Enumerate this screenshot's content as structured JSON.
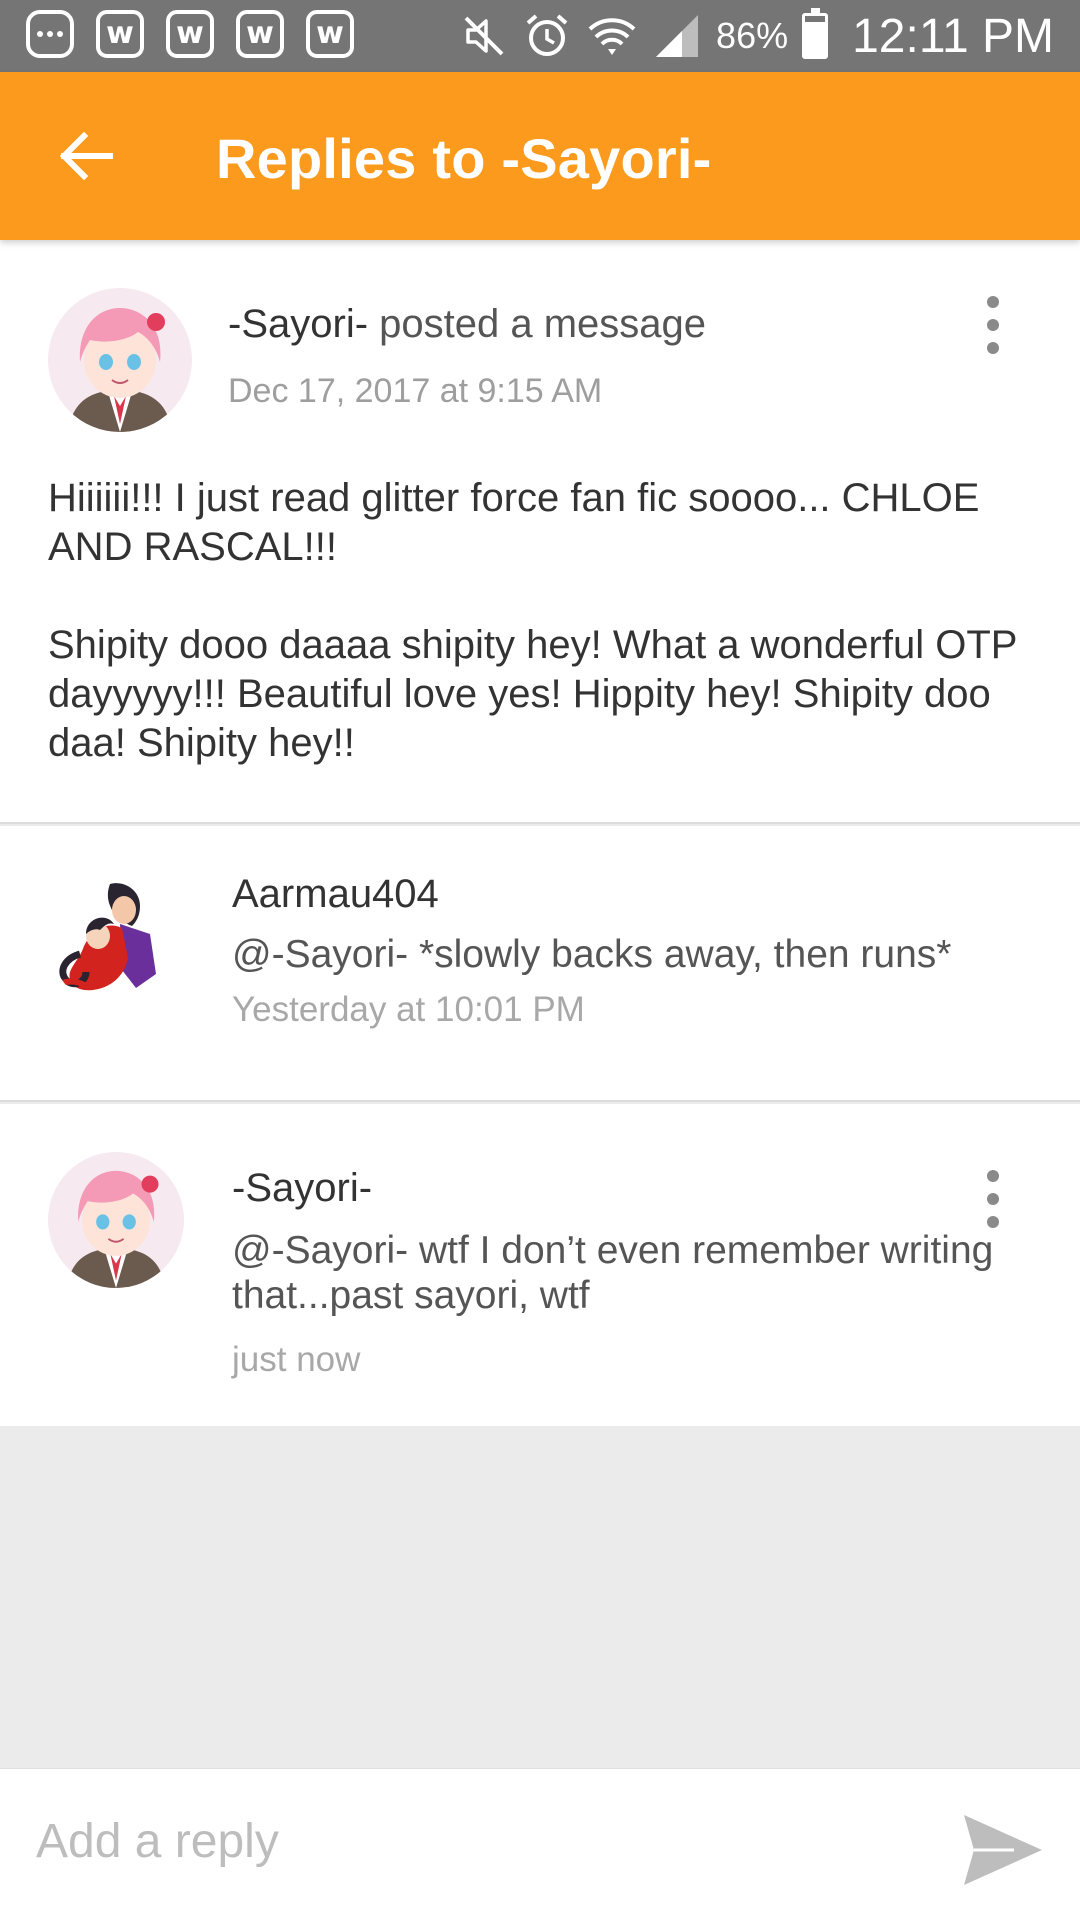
{
  "status_bar": {
    "notification_icons": [
      "more-icon",
      "webtoon-icon",
      "webtoon-icon",
      "webtoon-icon",
      "webtoon-icon"
    ],
    "right_icons": [
      "mute-icon",
      "alarm-icon",
      "wifi-icon",
      "signal-icon"
    ],
    "battery_percent": "86%",
    "battery_level": 0.86,
    "time": "12:11 PM"
  },
  "app_bar": {
    "title": "Replies to -Sayori-",
    "color": "#fb9a1c",
    "back_icon": "arrow-left-icon"
  },
  "post": {
    "username": "-Sayori-",
    "action": " posted a message",
    "timestamp": "Dec 17, 2017 at 9:15 AM",
    "body": [
      "Hiiiiii!!! I just read glitter force fan fic soooo... CHLOE AND RASCAL!!!",
      "Shipity dooo daaaa shipity hey! What a wonderful OTP dayyyyy!!! Beautiful love yes! Hippity hey! Shipity doo daa! Shipity hey!!"
    ]
  },
  "replies": [
    {
      "username": "Aarmau404",
      "text": "@-Sayori-  *slowly backs away, then runs*",
      "timestamp": "Yesterday at 10:01 PM"
    },
    {
      "username": "-Sayori-",
      "text": "@-Sayori- wtf I don’t even remember writing that...past sayori, wtf",
      "timestamp": "just now"
    }
  ],
  "reply_bar": {
    "placeholder": "Add a reply",
    "send_icon": "send-icon"
  }
}
